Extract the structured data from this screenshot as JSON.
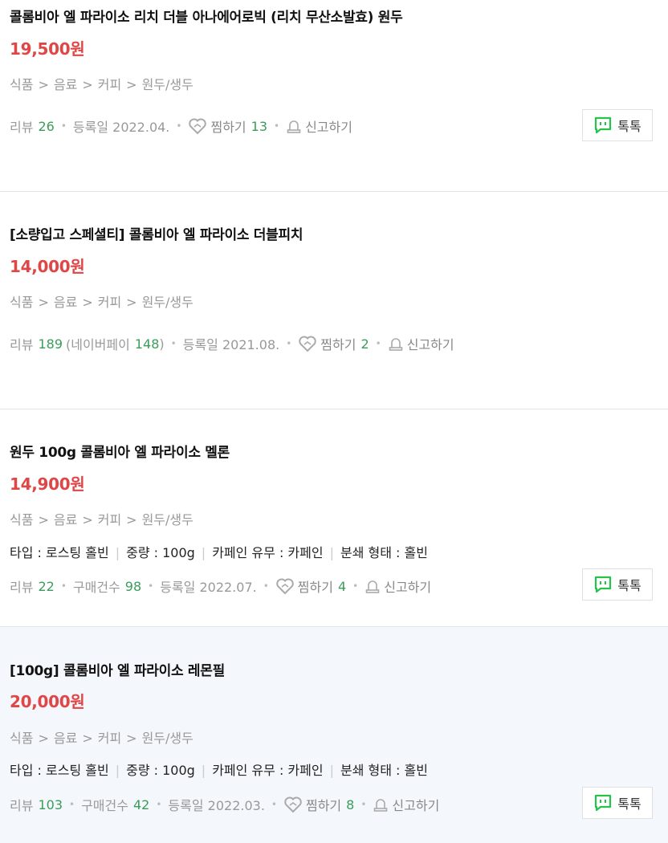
{
  "products": [
    {
      "title": "콜롬비아 엘 파라이소 리치 더블 아나에어로빅 (리치 무산소발효) 원두",
      "price": "19,500원",
      "categories": [
        "식품",
        "음료",
        "커피",
        "원두/생두"
      ],
      "review_label": "리뷰",
      "review_count": "26",
      "date": "등록일 2022.04.",
      "zzim_label": "찜하기",
      "zzim_count": "13",
      "report_label": "신고하기",
      "talk_label": "톡톡"
    },
    {
      "title": "[소량입고 스페셜티] 콜롬비아 엘 파라이소 더블피치",
      "price": "14,000원",
      "categories": [
        "식품",
        "음료",
        "커피",
        "원두/생두"
      ],
      "review_label": "리뷰",
      "review_count": "189",
      "naverpay_open": "(네이버페이",
      "naverpay_count": "148",
      "naverpay_close": ")",
      "date": "등록일 2021.08.",
      "zzim_label": "찜하기",
      "zzim_count": "2",
      "report_label": "신고하기"
    },
    {
      "title": "원두 100g 콜롬비아 엘 파라이소 멜론",
      "price": "14,900원",
      "categories": [
        "식품",
        "음료",
        "커피",
        "원두/생두"
      ],
      "attributes": [
        "타입 : 로스팅 홀빈",
        "중량 : 100g",
        "카페인 유무 : 카페인",
        "분쇄 형태 : 홀빈"
      ],
      "review_label": "리뷰",
      "review_count": "22",
      "purchase_label": "구매건수",
      "purchase_count": "98",
      "date": "등록일 2022.07.",
      "zzim_label": "찜하기",
      "zzim_count": "4",
      "report_label": "신고하기",
      "talk_label": "톡톡"
    },
    {
      "title": "[100g] 콜롬비아 엘 파라이소 레몬필",
      "price": "20,000원",
      "categories": [
        "식품",
        "음료",
        "커피",
        "원두/생두"
      ],
      "attributes": [
        "타입 : 로스팅 홀빈",
        "중량 : 100g",
        "카페인 유무 : 카페인",
        "분쇄 형태 : 홀빈"
      ],
      "review_label": "리뷰",
      "review_count": "103",
      "purchase_label": "구매건수",
      "purchase_count": "42",
      "date": "등록일 2022.03.",
      "zzim_label": "찜하기",
      "zzim_count": "8",
      "report_label": "신고하기",
      "talk_label": "톡톡"
    }
  ],
  "colors": {
    "price": "#e04646",
    "count": "#3a9d5a",
    "talk_icon": "#27c24c",
    "meta": "#999999"
  },
  "icons": {
    "zzim": "heart-icon",
    "report": "siren-icon",
    "talk": "talk-bubble-icon"
  }
}
